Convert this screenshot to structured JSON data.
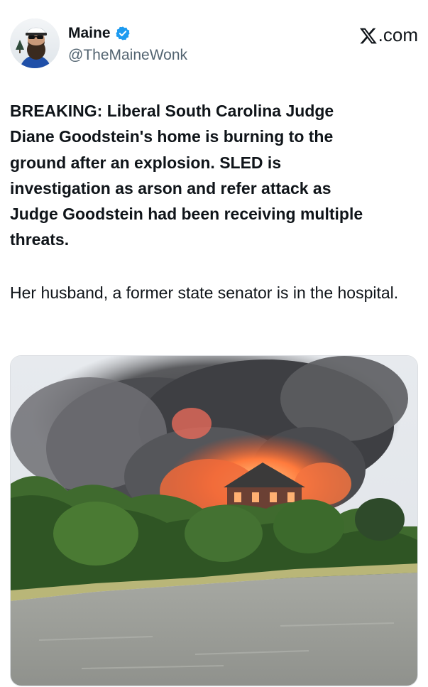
{
  "author": {
    "display_name": "Maine",
    "handle": "@TheMaineWonk",
    "verified": true,
    "verified_color": "#1d9bf0"
  },
  "brand": {
    "label": ".com",
    "icon": "x-logo-icon"
  },
  "post": {
    "headline": "BREAKING:  Liberal South Carolina Judge\nDiane Goodstein's home is burning to the\nground after an explosion. SLED is\ninvestigation as arson and refer attack as\nJudge Goodstein had been receiving multiple\nthreats.",
    "followup": "Her husband, a former state senator is in the hospital."
  },
  "media": {
    "type": "photo",
    "subject": "house-fire-photo"
  },
  "colors": {
    "text_primary": "#0f1419",
    "text_secondary": "#536471",
    "accent": "#1d9bf0"
  }
}
